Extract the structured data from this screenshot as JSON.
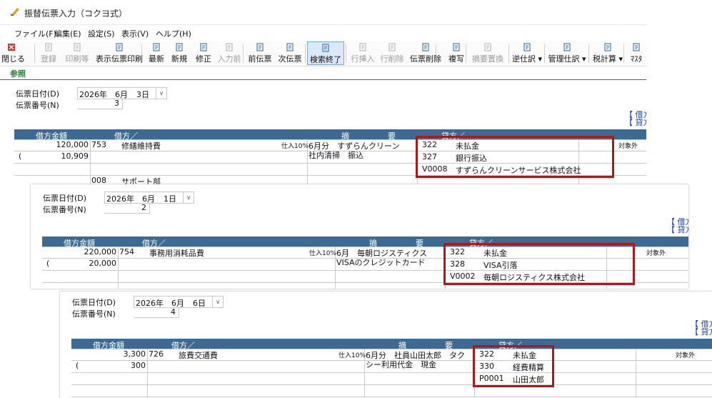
{
  "window": {
    "title": "振替伝票入力（コクヨ式）"
  },
  "menu": [
    "ファイル(F)",
    "編集(E)",
    "設定(S)",
    "表示(V)",
    "ヘルプ(H)"
  ],
  "toolbar": [
    {
      "label": "閉じる",
      "icon": "close-icon",
      "enabled": true
    },
    {
      "label": "登録",
      "icon": "save-icon",
      "enabled": false
    },
    {
      "label": "印刷等",
      "icon": "print-icon",
      "enabled": false
    },
    {
      "label": "表示伝票印刷",
      "icon": "print-icon",
      "enabled": true
    },
    {
      "label": "最新",
      "icon": "refresh-icon",
      "enabled": true
    },
    {
      "label": "新規",
      "icon": "new-doc-icon",
      "enabled": true
    },
    {
      "label": "修正",
      "icon": "edit-icon",
      "enabled": true
    },
    {
      "label": "入力前",
      "icon": "back-icon",
      "enabled": false
    },
    {
      "label": "前伝票",
      "icon": "prev-voucher-icon",
      "enabled": true
    },
    {
      "label": "次伝票",
      "icon": "next-voucher-icon",
      "enabled": true
    },
    {
      "label": "検索終了",
      "icon": "search-icon",
      "enabled": true,
      "active": true
    },
    {
      "label": "行挿入",
      "icon": "insert-row-icon",
      "enabled": false
    },
    {
      "label": "行削除",
      "icon": "delete-row-icon",
      "enabled": false
    },
    {
      "label": "伝票削除",
      "icon": "delete-voucher-icon",
      "enabled": true
    },
    {
      "label": "複写",
      "icon": "copy-icon",
      "enabled": true
    },
    {
      "label": "摘要置換",
      "icon": "replace-icon",
      "enabled": false
    },
    {
      "label": "逆仕訳",
      "icon": "reverse-icon",
      "enabled": true,
      "dropdown": true
    },
    {
      "label": "管理仕訳",
      "icon": "manage-icon",
      "enabled": true,
      "dropdown": true
    },
    {
      "label": "税計算",
      "icon": "tax-icon",
      "enabled": true,
      "dropdown": true
    },
    {
      "label": "ﾏｽﾀ",
      "icon": "master-icon",
      "enabled": true
    }
  ],
  "reference_tab": "参照",
  "labels": {
    "date": "伝票日付(D)",
    "number": "伝票番号(N)",
    "debit_amount": "借方金額",
    "debit": "借方／",
    "summary_a": "摘",
    "summary_b": "要",
    "credit": "貸方／",
    "side_debit": "【 借方",
    "side_credit": "【 貸方"
  },
  "vouchers": [
    {
      "date": {
        "year": "2026年",
        "month": "6月",
        "day": "3日"
      },
      "number": "3",
      "debit_amount": "120,000",
      "debit_code": "753",
      "debit_name": "修繕維持費",
      "tax_tag": "仕入10%",
      "tax_paren": "(",
      "tax_amount": "10,909",
      "dept_code": "008",
      "dept_name": "サポート部",
      "summary_line1": "6月分　すずらんクリーン",
      "summary_line2": "社内清掃　振込",
      "credit_rows": [
        {
          "code": "322",
          "name": "未払金"
        },
        {
          "code": "327",
          "name": "銀行振込"
        },
        {
          "code": "V0008",
          "name": "すずらんクリーンサービス株式会社"
        }
      ],
      "tax_scope": "対象外"
    },
    {
      "date": {
        "year": "2026年",
        "month": "6月",
        "day": "1日"
      },
      "number": "2",
      "debit_amount": "220,000",
      "debit_code": "754",
      "debit_name": "事務用消耗品費",
      "tax_tag": "仕入10%",
      "tax_paren": "(",
      "tax_amount": "20,000",
      "summary_line1": "6月　毎朝ロジスティクス",
      "summary_line2": "VISAのクレジットカード",
      "credit_rows": [
        {
          "code": "322",
          "name": "未払金"
        },
        {
          "code": "328",
          "name": "VISA引落"
        },
        {
          "code": "V0002",
          "name": "毎朝ロジスティクス株式会社"
        }
      ],
      "tax_scope": "対象外"
    },
    {
      "date": {
        "year": "2026年",
        "month": "6月",
        "day": "6日"
      },
      "number": "4",
      "debit_amount": "3,300",
      "debit_code": "726",
      "debit_name": "旅費交通費",
      "tax_tag": "仕入10%",
      "tax_paren": "(",
      "tax_amount": "300",
      "summary_line1": "6月分　社員山田太郎　タク",
      "summary_line2": "シー利用代金　現金",
      "credit_rows": [
        {
          "code": "322",
          "name": "未払金"
        },
        {
          "code": "330",
          "name": "経費精算"
        },
        {
          "code": "P0001",
          "name": "山田太郎"
        }
      ],
      "tax_scope": "対象外"
    }
  ],
  "colors": {
    "header": "#3b6b94",
    "highlight": "#b01818",
    "accent": "#2d7d3a",
    "link": "#1a3fb0"
  }
}
